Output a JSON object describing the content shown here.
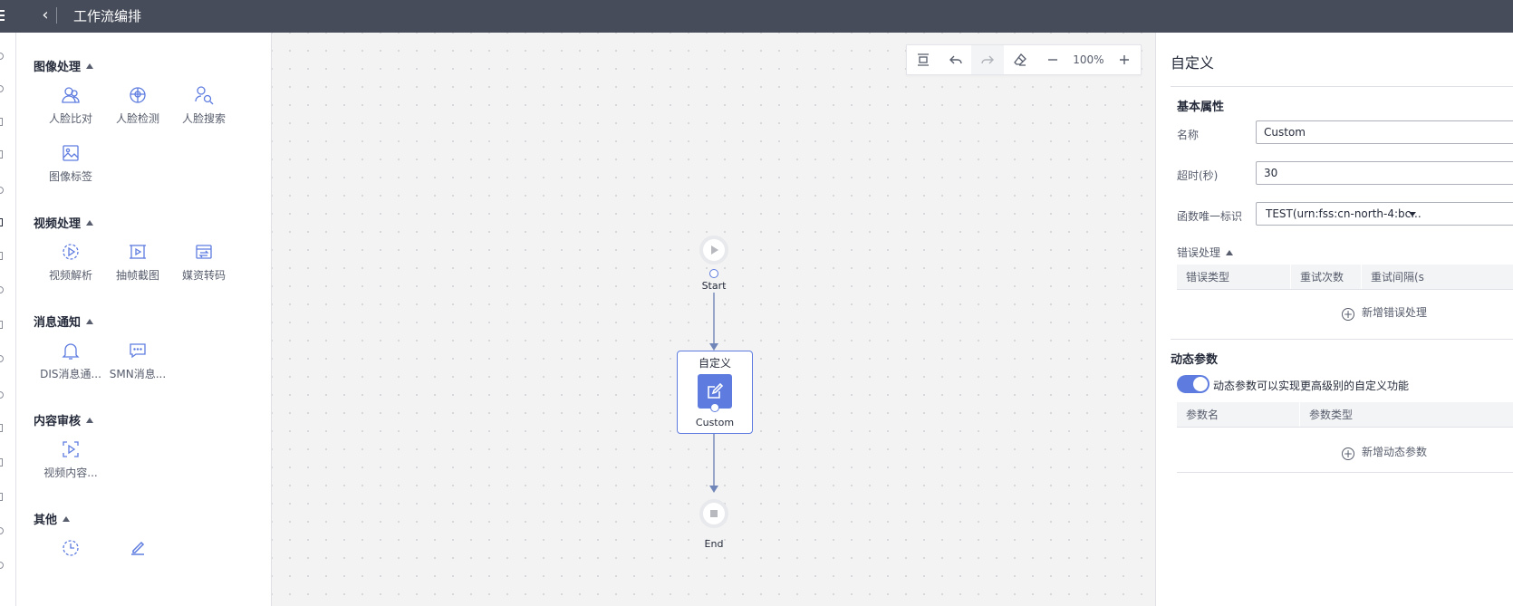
{
  "header": {
    "title": "工作流编排"
  },
  "palette": {
    "groups": [
      {
        "title": "图像处理",
        "items": [
          {
            "label": "人脸比对"
          },
          {
            "label": "人脸检测"
          },
          {
            "label": "人脸搜索"
          },
          {
            "label": "图像标签"
          }
        ]
      },
      {
        "title": "视频处理",
        "items": [
          {
            "label": "视频解析"
          },
          {
            "label": "抽帧截图"
          },
          {
            "label": "媒资转码"
          }
        ]
      },
      {
        "title": "消息通知",
        "items": [
          {
            "label": "DIS消息通..."
          },
          {
            "label": "SMN消息..."
          }
        ]
      },
      {
        "title": "内容审核",
        "items": [
          {
            "label": "视频内容..."
          }
        ]
      },
      {
        "title": "其他",
        "items": [
          {
            "label": ""
          },
          {
            "label": ""
          }
        ]
      }
    ]
  },
  "toolbar": {
    "zoom": "100%"
  },
  "flow": {
    "start_label": "Start",
    "custom_title": "自定义",
    "custom_label": "Custom",
    "end_label": "End"
  },
  "panel": {
    "title": "自定义",
    "basic_section": "基本属性",
    "name_label": "名称",
    "name_value": "Custom",
    "timeout_label": "超时(秒)",
    "timeout_value": "30",
    "func_label": "函数唯一标识",
    "func_value": "TEST(urn:fss:cn-north-4:bc...",
    "error_section": "错误处理",
    "error_cols": [
      "错误类型",
      "重试次数",
      "重试间隔(s"
    ],
    "add_error": "新增错误处理",
    "dynamic_section": "动态参数",
    "dynamic_desc": "动态参数可以实现更高级别的自定义功能",
    "dynamic_enabled": true,
    "param_cols": [
      "参数名",
      "参数类型"
    ],
    "add_param": "新增动态参数"
  },
  "colors": {
    "accent": "#5e7ce0",
    "topbar": "#474c5a",
    "canvas": "#f3f3f3"
  }
}
